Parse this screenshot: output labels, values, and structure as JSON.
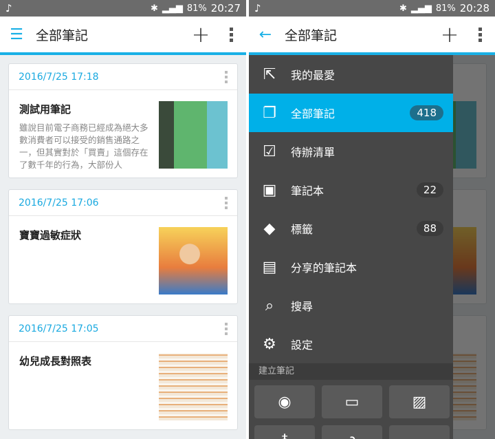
{
  "left": {
    "status": {
      "battery": "81%",
      "time": "20:27"
    },
    "title": "全部筆記",
    "notes": [
      {
        "date": "2016/7/25 17:18",
        "title": "測試用筆記",
        "snippet": "雖說目前電子商務已經成為絕大多數消費者可以接受的銷售通路之一，但其實對於「買賣」這個存在了數千年的行為，大部份人"
      },
      {
        "date": "2016/7/25 17:06",
        "title": "寶寶過敏症狀",
        "snippet": ""
      },
      {
        "date": "2016/7/25 17:05",
        "title": "幼兒成長對照表",
        "snippet": ""
      }
    ]
  },
  "right": {
    "status": {
      "battery": "81%",
      "time": "20:28"
    },
    "title": "全部筆記",
    "drawer": [
      {
        "label": "我的最愛",
        "icon": "shortcut-icon"
      },
      {
        "label": "全部筆記",
        "count": "418",
        "icon": "all-notes-icon"
      },
      {
        "label": "待辦清單",
        "icon": "checklist-icon"
      },
      {
        "label": "筆記本",
        "count": "22",
        "icon": "notebook-icon"
      },
      {
        "label": "標籤",
        "count": "88",
        "icon": "tag-icon"
      },
      {
        "label": "分享的筆記本",
        "icon": "shared-notebook-icon"
      },
      {
        "label": "搜尋",
        "icon": "search-icon"
      },
      {
        "label": "設定",
        "icon": "gear-icon"
      }
    ],
    "section": "建立筆記"
  },
  "colors": {
    "accent": "#19b0e6",
    "active": "#00b0e8"
  }
}
